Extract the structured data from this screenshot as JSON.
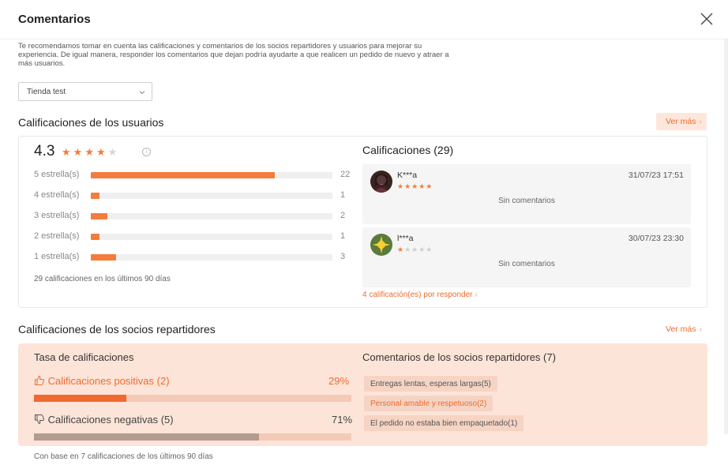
{
  "header": {
    "title": "Comentarios",
    "close_icon": "close-icon"
  },
  "intro": {
    "text": "Te recomendamos tomar en cuenta las calificaciones y comentarios de los socios repartidores y usuarios para mejorar su experiencia. De igual manera, responder los comentarios que dejan podría ayudarte a que realicen un pedido de nuevo y atraer a más usuarios."
  },
  "store_select": {
    "value": "Tienda test",
    "icon": "chevron-down-icon"
  },
  "users": {
    "title": "Calificaciones de los usuarios",
    "ver_mas": "Ver más",
    "average": "4.3",
    "average_stars": 4.3,
    "distribution": [
      {
        "label": "5 estrella(s)",
        "count": "22",
        "fraction": 0.76
      },
      {
        "label": "4 estrella(s)",
        "count": "1",
        "fraction": 0.035
      },
      {
        "label": "3 estrella(s)",
        "count": "2",
        "fraction": 0.069
      },
      {
        "label": "2 estrella(s)",
        "count": "1",
        "fraction": 0.035
      },
      {
        "label": "1 estrella(s)",
        "count": "3",
        "fraction": 0.104
      }
    ],
    "note": "29 calificaciones en los últimos 90 días",
    "reviews_title": "Calificaciones (29)",
    "reviews": [
      {
        "name": "K***a",
        "date": "31/07/23 17:51",
        "stars": 5,
        "comment": "Sin comentarios"
      },
      {
        "name": "l***a",
        "date": "30/07/23 23:30",
        "stars": 1,
        "comment": "Sin comentarios"
      }
    ],
    "pending": "4 calificación(es) por responder"
  },
  "riders": {
    "title": "Calificaciones de los socios repartidores",
    "ver_mas": "Ver más",
    "tasa_title": "Tasa de calificaciones",
    "positive_label": "Calificaciones positivas (2)",
    "positive_pct": "29%",
    "positive_fraction": 0.29,
    "negative_label": "Calificaciones negativas (5)",
    "negative_pct": "71%",
    "negative_fraction": 0.71,
    "comments_title": "Comentarios de los socios repartidores (7)",
    "tags": [
      "Entregas lentas, esperas largas(5)",
      "Personal amable y respetuoso(2)",
      "El pedido no estaba bien empaquetado(1)"
    ],
    "footer": "Con base en 7 calificaciones de los últimos 90 días"
  },
  "colors": {
    "accent": "#f47c3c",
    "negative_bar": "#b59a8e",
    "positive_bar": "#f06a2f"
  }
}
